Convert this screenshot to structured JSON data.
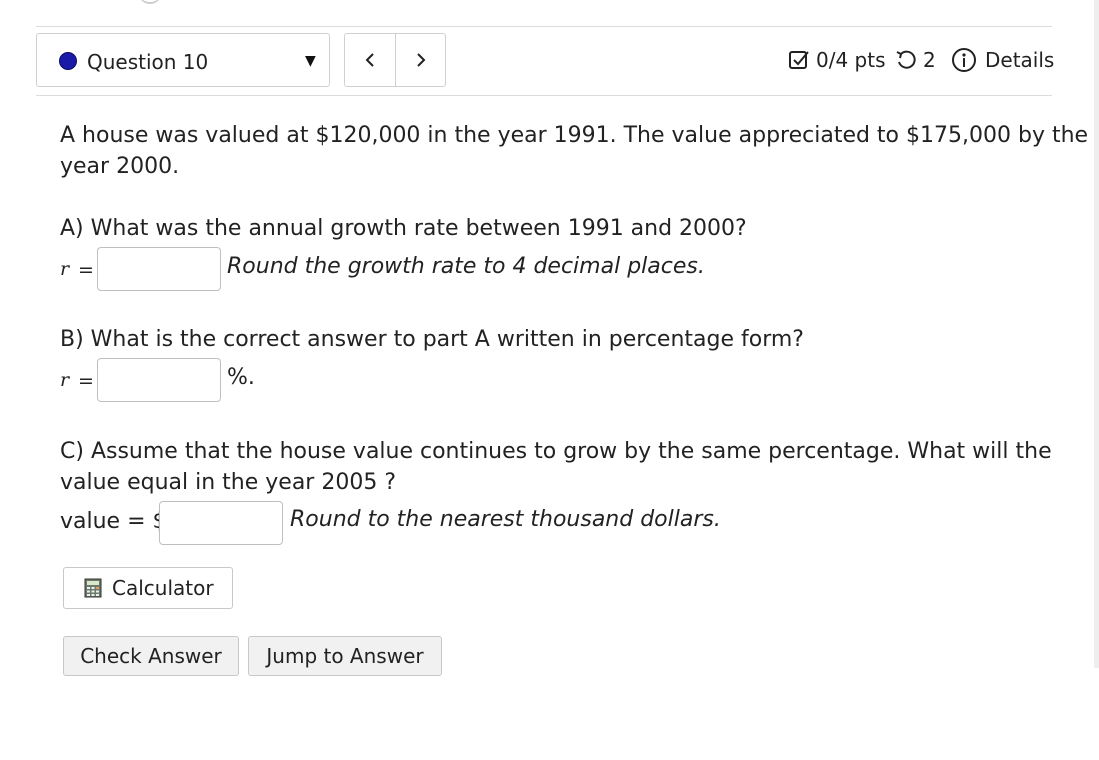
{
  "header": {
    "question_label": "Question 10",
    "points": "0/4 pts",
    "attempts": "2",
    "details_label": "Details"
  },
  "colors": {
    "status_dot": "#1a1aa8",
    "button_bg": "#f1f1f1",
    "border": "#d0d0d0"
  },
  "icons": {
    "status": "filled-circle-icon",
    "dropdown": "caret-down-icon",
    "prev": "chevron-left-icon",
    "next": "chevron-right-icon",
    "points": "checkbox-icon",
    "attempts": "retry-icon",
    "details": "info-icon",
    "calculator": "calculator-icon"
  },
  "question": {
    "intro_line1": "A house was valued at $120,000 in the year 1991. The value appreciated to $175,000 by the",
    "intro_line2": "year 2000.",
    "part_a": {
      "prompt": "A) What was the annual growth rate between 1991 and 2000?",
      "variable": "r",
      "equals": "=",
      "value": "",
      "hint": "Round the growth rate to 4 decimal places."
    },
    "part_b": {
      "prompt": "B) What is the correct answer to part A written in percentage form?",
      "variable": "r",
      "equals": "=",
      "value": "",
      "suffix": "%."
    },
    "part_c": {
      "prompt_line1": "C) Assume that the house value continues to grow by the same percentage. What will the",
      "prompt_line2": "value equal in the year 2005 ?",
      "label": "value = $",
      "value": "",
      "hint": "Round to the nearest thousand dollars."
    }
  },
  "buttons": {
    "calculator": "Calculator",
    "check_answer": "Check Answer",
    "jump_to_answer": "Jump to Answer"
  }
}
